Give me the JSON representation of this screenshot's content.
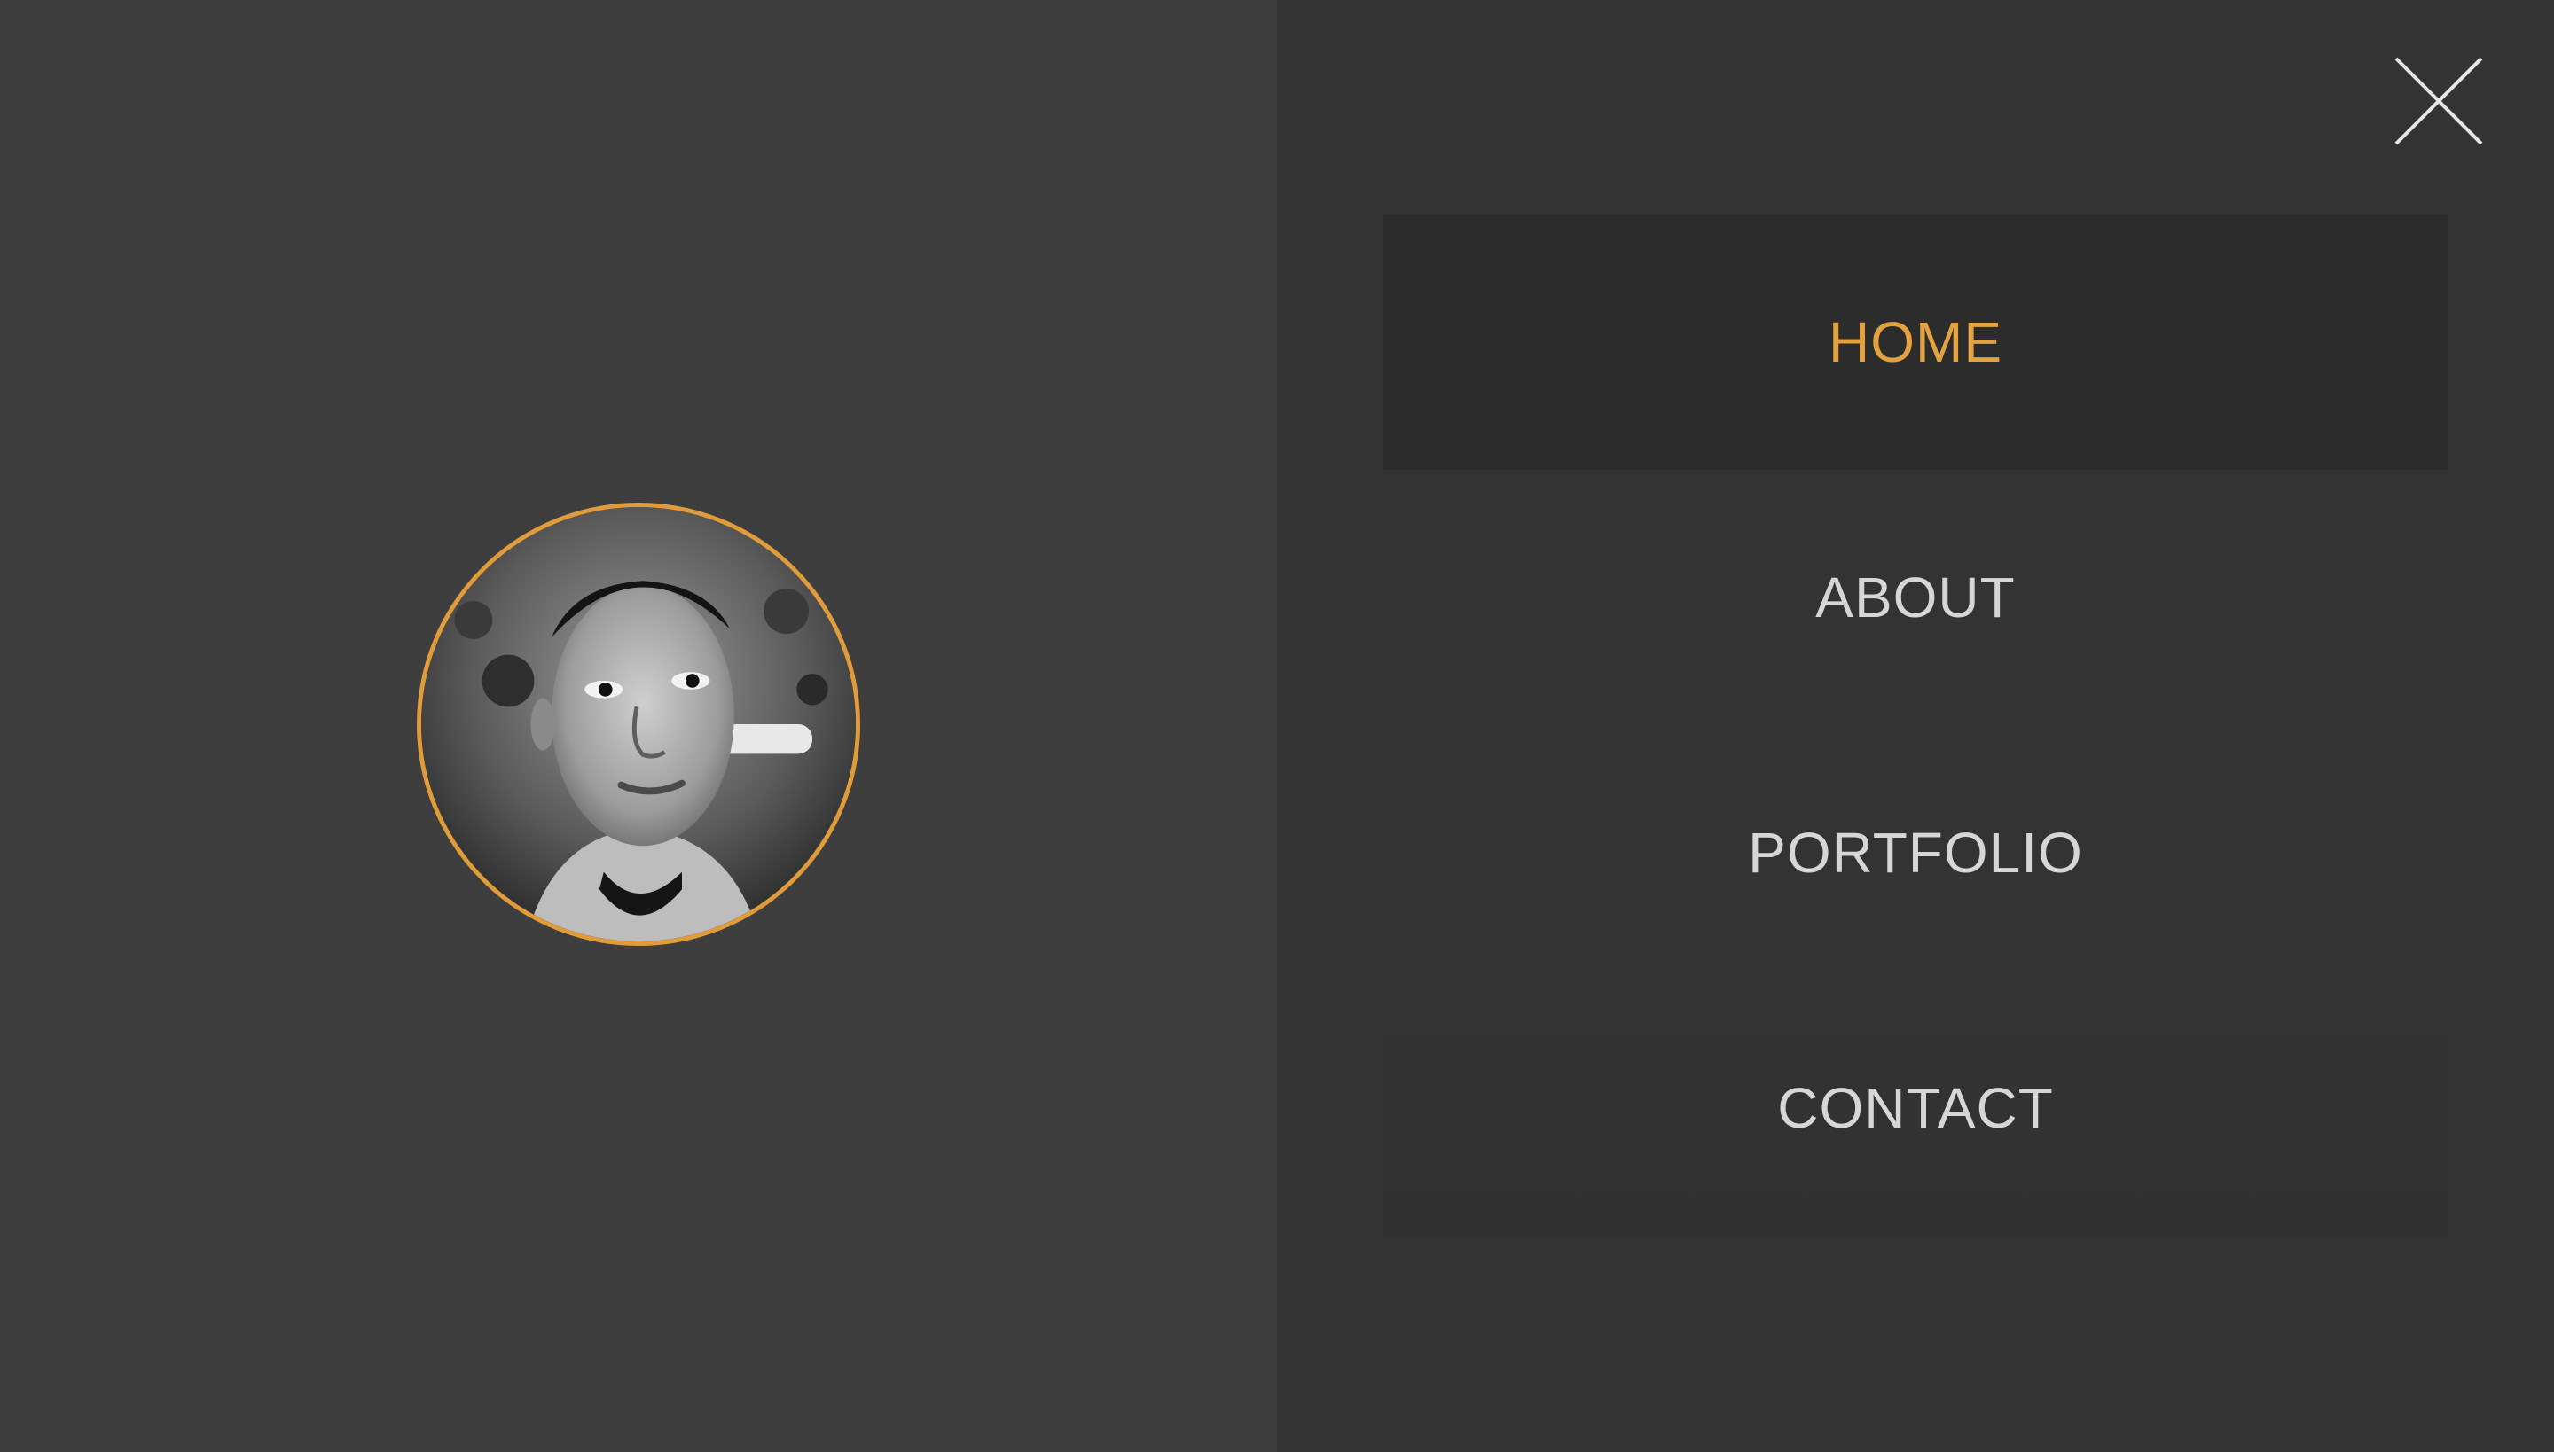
{
  "colors": {
    "accent": "#e3a140",
    "panel_bg": "#333333",
    "page_bg": "#3e3e3e",
    "nav_text": "#d6d6d6",
    "active_bg": "#2c2c2c"
  },
  "hero": {
    "avatar_alt": "profile photo"
  },
  "nav": {
    "close_icon": "close-icon",
    "items": [
      {
        "label": "HOME",
        "active": true
      },
      {
        "label": "ABOUT",
        "active": false
      },
      {
        "label": "PORTFOLIO",
        "active": false
      },
      {
        "label": "CONTACT",
        "active": false
      }
    ]
  }
}
